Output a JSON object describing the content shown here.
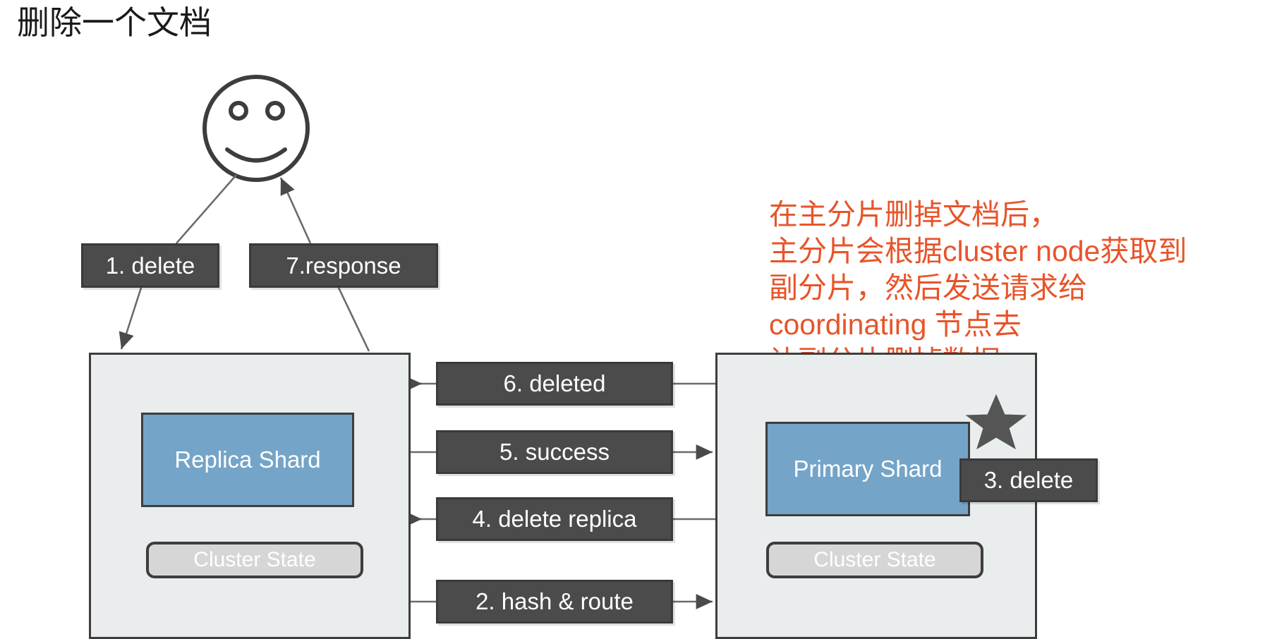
{
  "slide": {
    "title": "删除一个文档",
    "corner_title": " "
  },
  "annotation": {
    "color": "#e8542a",
    "lines": [
      "在主分片删掉文档后，",
      "主分片会根据cluster node获取到",
      "副分片，然后发送请求给",
      "coordinating 节点去",
      "让副分片删掉数据"
    ],
    "text": "在主分片删掉文档后，\n主分片会根据cluster node获取到\n副分片，然后发送请求给\ncoordinating 节点去\n让副分片删掉数据"
  },
  "actor": {
    "name": "client-smiley-face"
  },
  "nodes": [
    {
      "id": "replica-node",
      "shard_label": "Replica Shard",
      "cluster_state_label": "Cluster State",
      "fill": "#e9edee",
      "shard_fill": "#74a4c8"
    },
    {
      "id": "primary-node",
      "shard_label": "Primary Shard",
      "cluster_state_label": "Cluster State",
      "fill": "#e9edee",
      "shard_fill": "#74a4c8",
      "starred": true
    }
  ],
  "steps": {
    "s1": "1. delete",
    "s7": "7.response",
    "s6": "6. deleted",
    "s5": "5. success",
    "s4": "4. delete replica",
    "s2": "2. hash & route",
    "s3": "3. delete"
  },
  "colors": {
    "step_box": "#4b4b4b",
    "step_text": "#ffffff",
    "node_border": "#3d3d3d",
    "node_fill": "#e9edee",
    "shard_fill": "#74a4c8",
    "cluster_state_fill": "#d6d6d6",
    "annotation": "#e8542a",
    "title": "#1a1a1a"
  }
}
